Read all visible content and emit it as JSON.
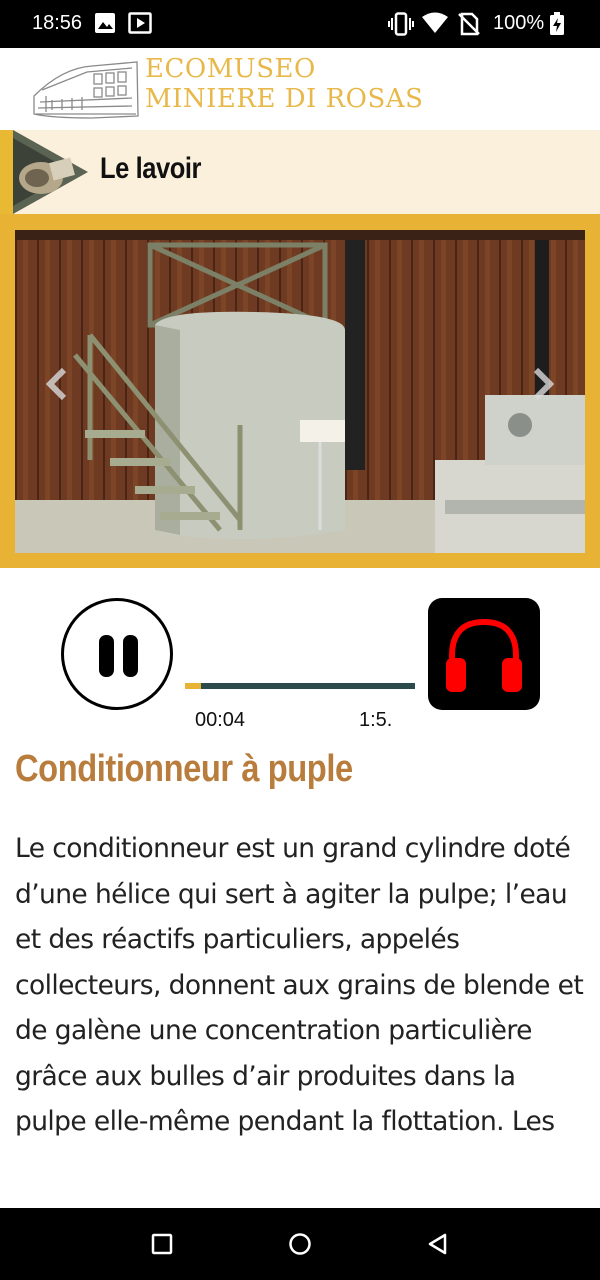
{
  "status_bar": {
    "time": "18:56",
    "battery": "100%",
    "icons": [
      "image-icon",
      "cast-icon",
      "vibrate-icon",
      "wifi-icon",
      "no-sim-icon",
      "battery-charging-icon"
    ]
  },
  "header": {
    "logo_line1": "ECOMUSEO",
    "logo_line2": "MINIERE DI ROSAS"
  },
  "section": {
    "title": "Le lavoir"
  },
  "player": {
    "current_time": "00:04",
    "total_time": "1:5.",
    "progress": 0.07
  },
  "article": {
    "title": "Conditionneur à puple",
    "body": "Le conditionneur est un grand cylindre doté d’une hélice qui sert à agiter la pulpe; l’eau et des réactifs particuliers, appelés collecteurs, donnent aux grains de blende et de galène une concentration particulière grâce aux bulles d’air produites dans la pulpe elle-même pendant la flottation. Les réactifs collecteurs utilisés sont des"
  },
  "colors": {
    "accent_gold": "#e8b334",
    "title_brown": "#b87d3c",
    "headphone_red": "#ff0000",
    "track_dark": "#2b4a4a"
  }
}
